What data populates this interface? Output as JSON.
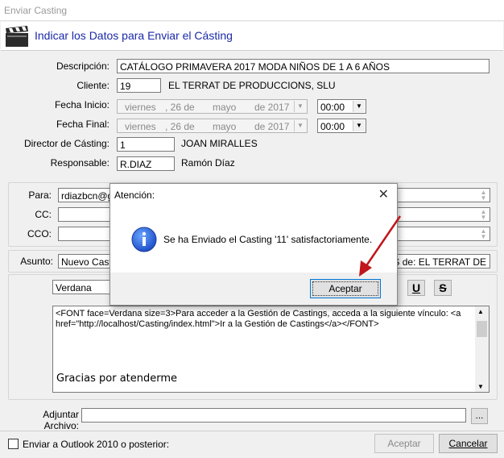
{
  "window": {
    "title": "Enviar Casting"
  },
  "header": {
    "title": "Indicar los Datos para Enviar el Cásting",
    "icon": "clapperboard-icon"
  },
  "form": {
    "descripcion_label": "Descripción:",
    "descripcion_value": "CATÁLOGO PRIMAVERA 2017 MODA NIÑOS DE 1 A 6 AÑOS",
    "cliente_label": "Cliente:",
    "cliente_value": "19",
    "cliente_name": "EL TERRAT DE PRODUCCIONS, SLU",
    "fecha_inicio_label": "Fecha Inicio:",
    "fecha_inicio": {
      "weekday": "viernes",
      "day": ", 26 de",
      "month": "mayo",
      "year": "de 2017",
      "time": "00:00"
    },
    "fecha_final_label": "Fecha Final:",
    "fecha_final": {
      "weekday": "viernes",
      "day": ", 26 de",
      "month": "mayo",
      "year": "de 2017",
      "time": "00:00"
    },
    "director_label": "Director de Cásting:",
    "director_value": "1",
    "director_name": "JOAN MIRALLES",
    "responsable_label": "Responsable:",
    "responsable_value": "R.DIAZ",
    "responsable_name": "Ramón Díaz"
  },
  "mail": {
    "para_label": "Para:",
    "para_value": "rdiazbcn@gm",
    "cc_label": "CC:",
    "cc_value": "",
    "cco_label": "CCO:",
    "cco_value": "",
    "asunto_label": "Asunto:",
    "asunto_left": "Nuevo Castin",
    "asunto_right": "OS de: EL TERRAT DE",
    "font_value": "Verdana",
    "underline_label": "U",
    "strike_label": "S",
    "body_code": "<FONT face=Verdana size=3>Para acceder a la Gestión de Castings, acceda a la siguiente vínculo: <a href=\"http://localhost/Casting/index.html\">Ir a la Gestión de Castings</a></FONT>",
    "body_text": "Gracias por atenderme",
    "adjuntar_label": "Adjuntar Archivo:",
    "adjuntar_value": "",
    "browse_label": "..."
  },
  "footer": {
    "outlook_label": "Enviar a Outlook 2010 o posterior:",
    "aceptar_label": "Aceptar",
    "cancelar_label": "Cancelar"
  },
  "dialog": {
    "title": "Atención:",
    "close": "✕",
    "message": "Se ha Enviado el Casting '11' satisfactoriamente.",
    "ok_label": "Aceptar",
    "icon": "info-icon"
  },
  "colors": {
    "accent": "#1a2aa8",
    "arrow": "#c0161c",
    "dialog_button_border": "#0078d7"
  }
}
